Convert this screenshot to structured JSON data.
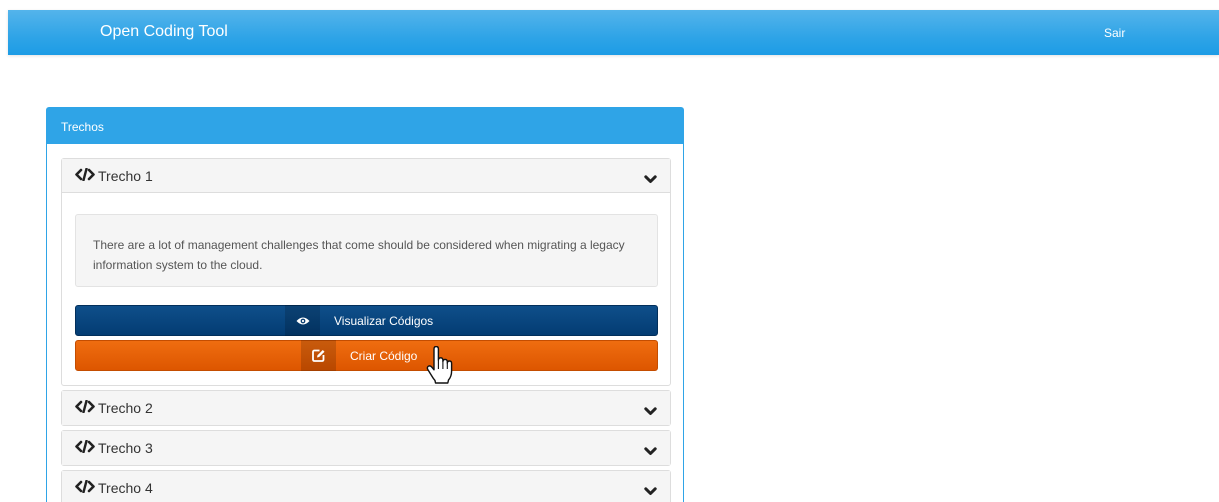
{
  "navbar": {
    "brand": "Open Coding Tool",
    "logout_label": "Sair"
  },
  "panel": {
    "title": "Trechos"
  },
  "excerpts": [
    {
      "title": "Trecho 1",
      "expanded": true,
      "text": "There are a lot of management challenges that come should be considered when migrating a legacy information system to the cloud.",
      "view_codes_label": "Visualizar Códigos",
      "create_code_label": "Criar Código"
    },
    {
      "title": "Trecho 2",
      "expanded": false
    },
    {
      "title": "Trecho 3",
      "expanded": false
    },
    {
      "title": "Trecho 4",
      "expanded": false
    }
  ],
  "icons": {
    "code": "code-icon",
    "chevron": "chevron-down-icon",
    "view": "eye-icon",
    "create": "edit-icon",
    "pointer": "hand-pointer-cursor"
  },
  "colors": {
    "primary": "#2fa4e7",
    "view_button": "#033c73",
    "create_button": "#dd5600"
  }
}
